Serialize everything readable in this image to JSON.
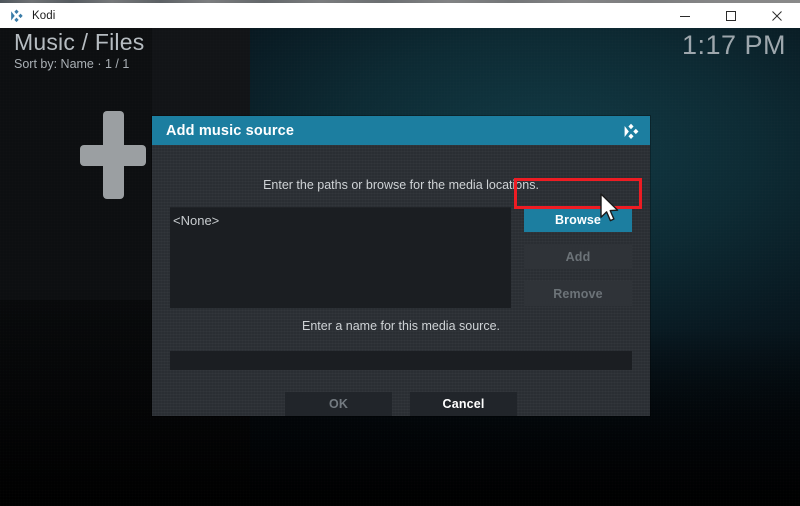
{
  "window": {
    "taskbar_icon": "kodi-icon",
    "app_name": "Kodi",
    "controls": {
      "minimize": "minimize-icon",
      "maximize": "maximize-icon",
      "close": "close-icon"
    }
  },
  "kodi": {
    "breadcrumb": "Music / Files",
    "subtitle": "Sort by: Name  ·  1 / 1",
    "clock": "1:17 PM",
    "background_art": "plus-icon"
  },
  "dialog": {
    "title": "Add music source",
    "logo": "kodi-logo-icon",
    "hint_paths": "Enter the paths or browse for the media locations.",
    "paths": [
      "<None>"
    ],
    "side_buttons": [
      {
        "label": "Browse",
        "state": "focused"
      },
      {
        "label": "Add",
        "state": "disabled"
      },
      {
        "label": "Remove",
        "state": "disabled"
      }
    ],
    "hint_name": "Enter a name for this media source.",
    "name_value": "",
    "name_placeholder": "",
    "bottom_buttons": [
      {
        "label": "OK",
        "state": "disabled"
      },
      {
        "label": "Cancel",
        "state": "enabled"
      }
    ]
  },
  "annotation": {
    "target": "Browse",
    "color": "#ee1c23"
  },
  "colors": {
    "accent": "#1c7ea0",
    "dialog_bg": "#2a2e33",
    "field_bg": "#1b1e22",
    "annotation": "#ee1c23"
  }
}
